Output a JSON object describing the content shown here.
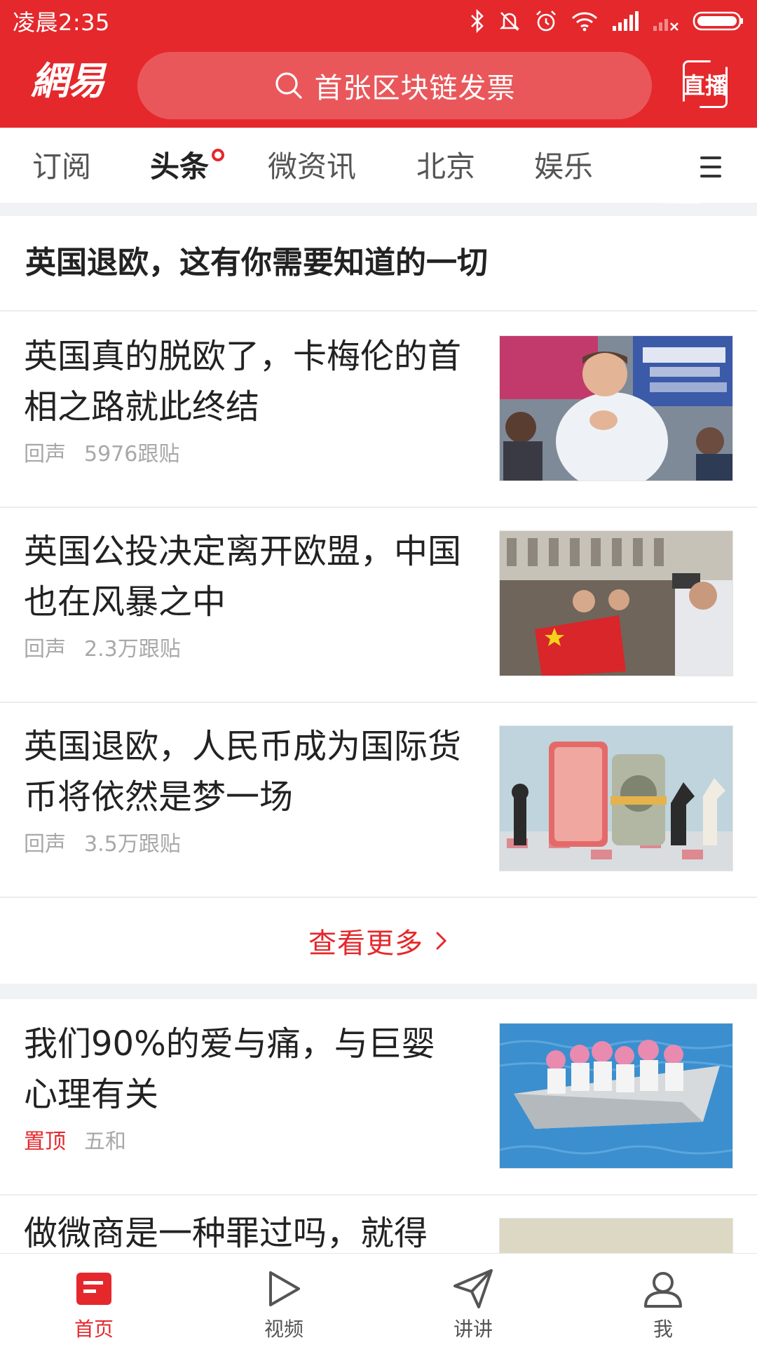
{
  "status_bar": {
    "time": "凌晨2:35"
  },
  "header": {
    "logo_text": "網易",
    "search_placeholder": "首张区块链发票",
    "live_label": "直播"
  },
  "tabs": [
    {
      "label": "订阅",
      "active": false
    },
    {
      "label": "头条",
      "active": true,
      "has_dot": true
    },
    {
      "label": "微资讯",
      "active": false
    },
    {
      "label": "北京",
      "active": false
    },
    {
      "label": "娱乐",
      "active": false
    }
  ],
  "topic": {
    "title": "英国退欧，这有你需要知道的一切"
  },
  "news": [
    {
      "title": "英国真的脱欧了，卡梅伦的首相之路就此终结",
      "source": "回声",
      "comments": "5976跟贴"
    },
    {
      "title": "英国公投决定离开欧盟，中国也在风暴之中",
      "source": "回声",
      "comments": "2.3万跟贴"
    },
    {
      "title": "英国退欧，人民币成为国际货币将依然是梦一场",
      "source": "回声",
      "comments": "3.5万跟贴"
    }
  ],
  "more": {
    "label": "查看更多"
  },
  "feed": [
    {
      "title": "我们90%的爱与痛，与巨婴心理有关",
      "pin_label": "置顶",
      "source": "五和"
    },
    {
      "title": "做微商是一种罪过吗，就得"
    }
  ],
  "bottom_nav": [
    {
      "label": "首页",
      "icon": "home-icon",
      "active": true
    },
    {
      "label": "视频",
      "icon": "play-icon",
      "active": false
    },
    {
      "label": "讲讲",
      "icon": "paper-plane-icon",
      "active": false
    },
    {
      "label": "我",
      "icon": "user-icon",
      "active": false
    }
  ],
  "colors": {
    "brand_red": "#e5282c",
    "meta_gray": "#a8a8a8",
    "text_dark": "#222222"
  }
}
